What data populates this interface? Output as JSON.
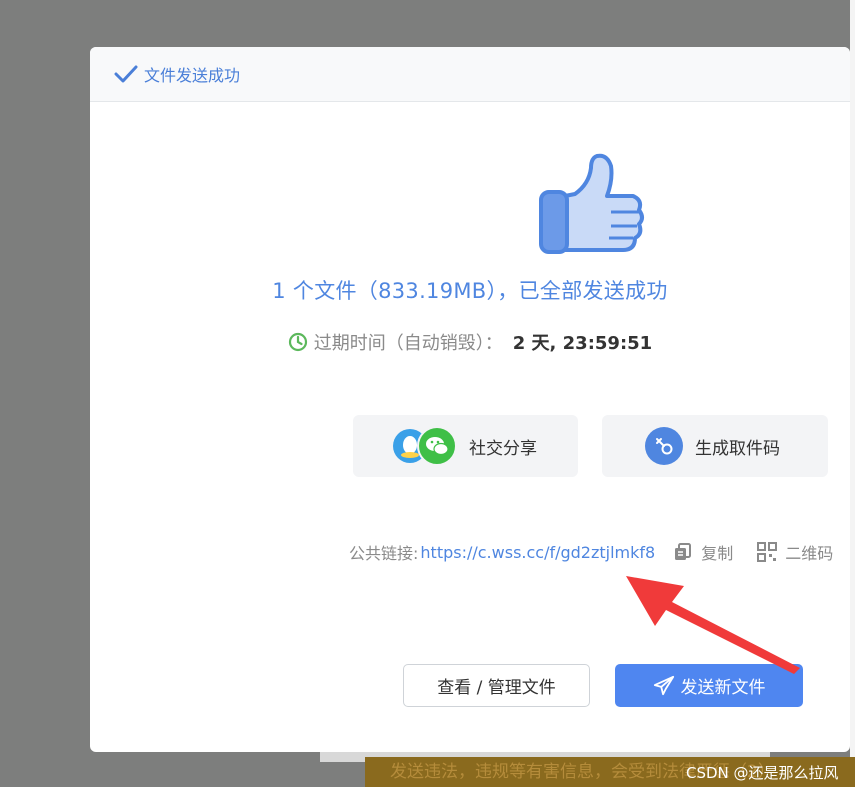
{
  "dialog": {
    "title": "文件发送成功",
    "success_message": "1 个文件（833.19MB），已全部发送成功",
    "expire_label": "过期时间（自动销毁）：",
    "expire_value": "2 天, 23:59:51"
  },
  "actions": {
    "share_label": "社交分享",
    "code_label": "生成取件码"
  },
  "link": {
    "label": "公共链接:",
    "url": "https://c.wss.cc/f/gd2ztjlmkf8",
    "copy_label": "复制",
    "qr_label": "二维码"
  },
  "buttons": {
    "manage_label": "查看 / 管理文件",
    "send_new_label": "发送新文件"
  },
  "background": {
    "banner_text": "发送违法，违规等有害信息，会受到法律严惩（2）",
    "watermark": "CSDN @还是那么拉风"
  },
  "colors": {
    "accent": "#4f86e0",
    "annotation_arrow": "#f03a3a"
  },
  "icons": [
    "check-icon",
    "thumbs-up-icon",
    "clock-icon",
    "qq-icon",
    "wechat-icon",
    "key-icon",
    "copy-icon",
    "qrcode-icon",
    "paper-plane-icon",
    "red-arrow-annotation"
  ]
}
